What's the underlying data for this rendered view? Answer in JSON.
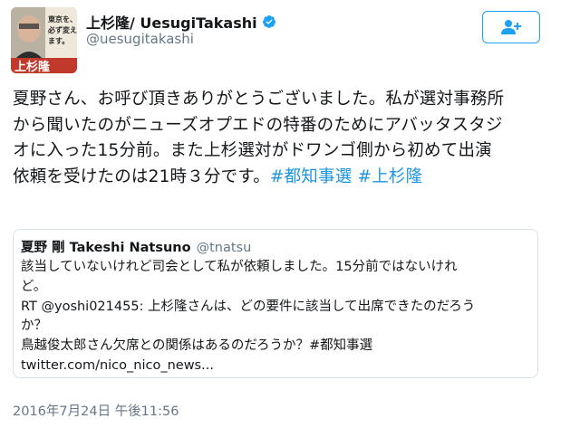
{
  "author": {
    "display_name": "上杉隆/ UesugiTakashi",
    "handle": "@uesugitakashi",
    "avatar_book_name": "上杉隆",
    "avatar_caption": "東京を、必ず変えます"
  },
  "follow_button": {
    "icon": "add-user-icon"
  },
  "tweet": {
    "lines": [
      "夏野さん、お呼び頂きありがとうございました。私が選対事務所",
      "から聞いたのがニューズオプエドの特番のためにアバッタスタジ",
      "オに入った15分前。また上杉選対がドワンゴ側から初めて出演",
      "依頼を受けたのは21時３分です。"
    ],
    "hashtags": [
      "#都知事選",
      "#上杉隆"
    ]
  },
  "quoted_tweet": {
    "name": "夏野 剛 Takeshi Natsuno",
    "handle": "@tnatsu",
    "lines": [
      "該当していないけれど司会として私が依頼しました。15分前ではないけれ",
      "ど。",
      "RT @yoshi021455: 上杉隆さんは、どの要件に該当して出席できたのだろう",
      "か？",
      "鳥越俊太郎さん欠席との関係はあるのだろうか？#都知事選",
      "twitter.com/nico_nico_news..."
    ]
  },
  "timestamp": "2016年7月24日 午後11:56",
  "colors": {
    "link": "#1b95e0",
    "verified": "#1da1f2",
    "secondary_text": "#657786",
    "border": "#d9e1e8"
  }
}
